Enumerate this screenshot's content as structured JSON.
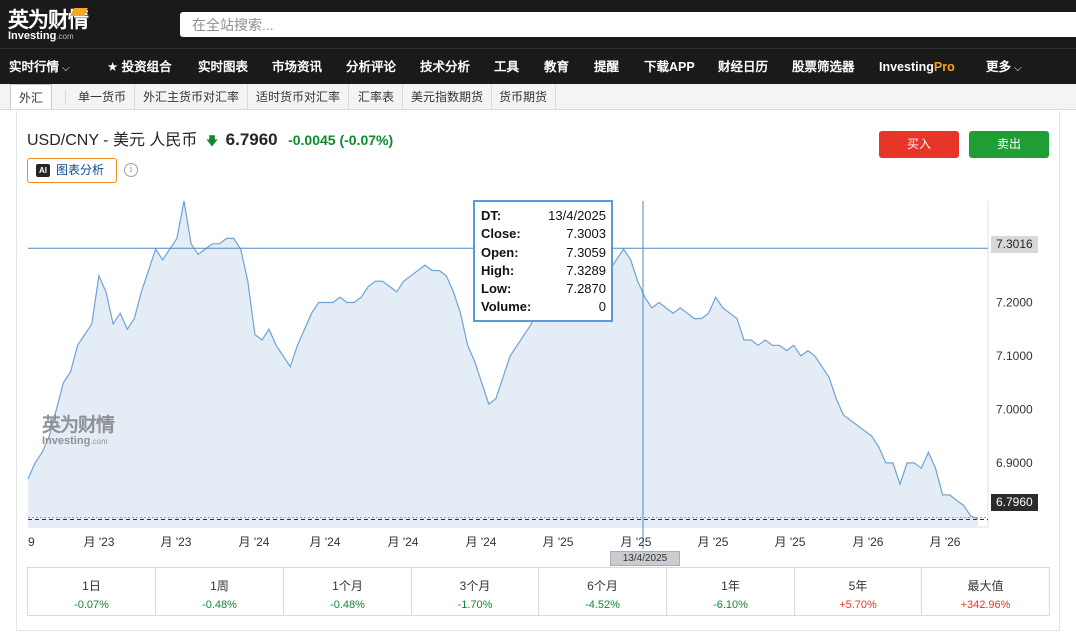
{
  "header": {
    "logo_cn": "英为财情",
    "logo_en": "Investing",
    "logo_en_suffix": ".com",
    "search_placeholder": "在全站搜索..."
  },
  "nav": {
    "items": [
      {
        "label": "实时行情"
      },
      {
        "label": "★ 投资组合"
      },
      {
        "label": "实时图表"
      },
      {
        "label": "市场资讯"
      },
      {
        "label": "分析评论"
      },
      {
        "label": "技术分析"
      },
      {
        "label": "工具"
      },
      {
        "label": "教育"
      },
      {
        "label": "提醒"
      },
      {
        "label": "下载APP"
      },
      {
        "label": "财经日历"
      },
      {
        "label": "股票筛选器"
      },
      {
        "label": "Investing"
      },
      {
        "label": "更多"
      }
    ],
    "pro_suffix": "Pro"
  },
  "subnav": {
    "items": [
      {
        "label": "外汇"
      },
      {
        "label": "单一货币"
      },
      {
        "label": "外汇主货币对汇率"
      },
      {
        "label": "适时货币对汇率"
      },
      {
        "label": "汇率表"
      },
      {
        "label": "美元指数期货"
      },
      {
        "label": "货币期货"
      }
    ]
  },
  "instrument": {
    "name": "USD/CNY - 美元 人民币",
    "price": "6.7960",
    "change": "-0.0045",
    "change_pct": "(-0.07%)",
    "direction": "down",
    "color_down": "#0e8a2d"
  },
  "actions": {
    "buy_label": "买入",
    "sell_label": "卖出",
    "buy_color": "#e8352a",
    "sell_color": "#1f9e35",
    "ai_badge": "AI",
    "ai_label": "图表分析"
  },
  "tooltip": {
    "rows": [
      {
        "k": "DT:",
        "v": "13/4/2025"
      },
      {
        "k": "Close:",
        "v": "7.3003"
      },
      {
        "k": "Open:",
        "v": "7.3059"
      },
      {
        "k": "High:",
        "v": "7.3289"
      },
      {
        "k": "Low:",
        "v": "7.2870"
      },
      {
        "k": "Volume:",
        "v": "0"
      }
    ]
  },
  "crosshair": {
    "price_tag": "7.3016",
    "date_tag": "13/4/2025"
  },
  "last_price_tag": "6.7960",
  "chart_data": {
    "type": "area",
    "ylim": [
      6.78,
      7.39
    ],
    "y_ticks": [
      7.2,
      7.1,
      7.0,
      6.9
    ],
    "y_tick_labels": [
      "7.2000",
      "7.1000",
      "7.0000",
      "6.9000"
    ],
    "x_tick_labels": [
      "9",
      "月 '23",
      "月 '23",
      "月 '24",
      "月 '24",
      "月 '24",
      "月 '24",
      "月 '25",
      "月 '25",
      "月 '25",
      "月 '25",
      "月 '26",
      "月 '26"
    ],
    "series": [
      {
        "values": [
          6.87,
          6.9,
          6.92,
          6.95,
          7.0,
          7.05,
          7.07,
          7.12,
          7.14,
          7.16,
          7.25,
          7.22,
          7.16,
          7.18,
          7.15,
          7.17,
          7.22,
          7.26,
          7.3,
          7.28,
          7.3,
          7.32,
          7.39,
          7.31,
          7.29,
          7.3,
          7.31,
          7.31,
          7.32,
          7.32,
          7.3,
          7.24,
          7.14,
          7.13,
          7.15,
          7.12,
          7.1,
          7.08,
          7.12,
          7.15,
          7.18,
          7.2,
          7.2,
          7.2,
          7.21,
          7.2,
          7.2,
          7.21,
          7.23,
          7.24,
          7.24,
          7.23,
          7.22,
          7.24,
          7.25,
          7.26,
          7.27,
          7.26,
          7.26,
          7.25,
          7.22,
          7.18,
          7.12,
          7.09,
          7.05,
          7.01,
          7.02,
          7.06,
          7.1,
          7.12,
          7.14,
          7.16,
          7.2,
          7.22,
          7.24,
          7.25,
          7.26,
          7.27,
          7.28,
          7.28,
          7.27,
          7.25,
          7.26,
          7.28,
          7.3,
          7.28,
          7.24,
          7.21,
          7.19,
          7.2,
          7.19,
          7.18,
          7.19,
          7.18,
          7.17,
          7.17,
          7.18,
          7.21,
          7.19,
          7.18,
          7.17,
          7.13,
          7.13,
          7.12,
          7.13,
          7.12,
          7.12,
          7.11,
          7.12,
          7.1,
          7.11,
          7.1,
          7.08,
          7.06,
          7.02,
          6.99,
          6.98,
          6.97,
          6.96,
          6.95,
          6.93,
          6.9,
          6.9,
          6.86,
          6.9,
          6.9,
          6.89,
          6.92,
          6.89,
          6.84,
          6.84,
          6.83,
          6.82,
          6.8,
          6.796
        ]
      }
    ],
    "grid": false,
    "legend": "none",
    "line_color": "#6ea2d4",
    "fill_color": "#e4edf6"
  },
  "performance": [
    {
      "label": "1日",
      "value": "-0.07%",
      "sign": "neg"
    },
    {
      "label": "1周",
      "value": "-0.48%",
      "sign": "neg"
    },
    {
      "label": "1个月",
      "value": "-0.48%",
      "sign": "neg"
    },
    {
      "label": "3个月",
      "value": "-1.70%",
      "sign": "neg"
    },
    {
      "label": "6个月",
      "value": "-4.52%",
      "sign": "neg"
    },
    {
      "label": "1年",
      "value": "-6.10%",
      "sign": "neg"
    },
    {
      "label": "5年",
      "value": "+5.70%",
      "sign": "pos"
    },
    {
      "label": "最大值",
      "value": "+342.96%",
      "sign": "pos"
    }
  ]
}
